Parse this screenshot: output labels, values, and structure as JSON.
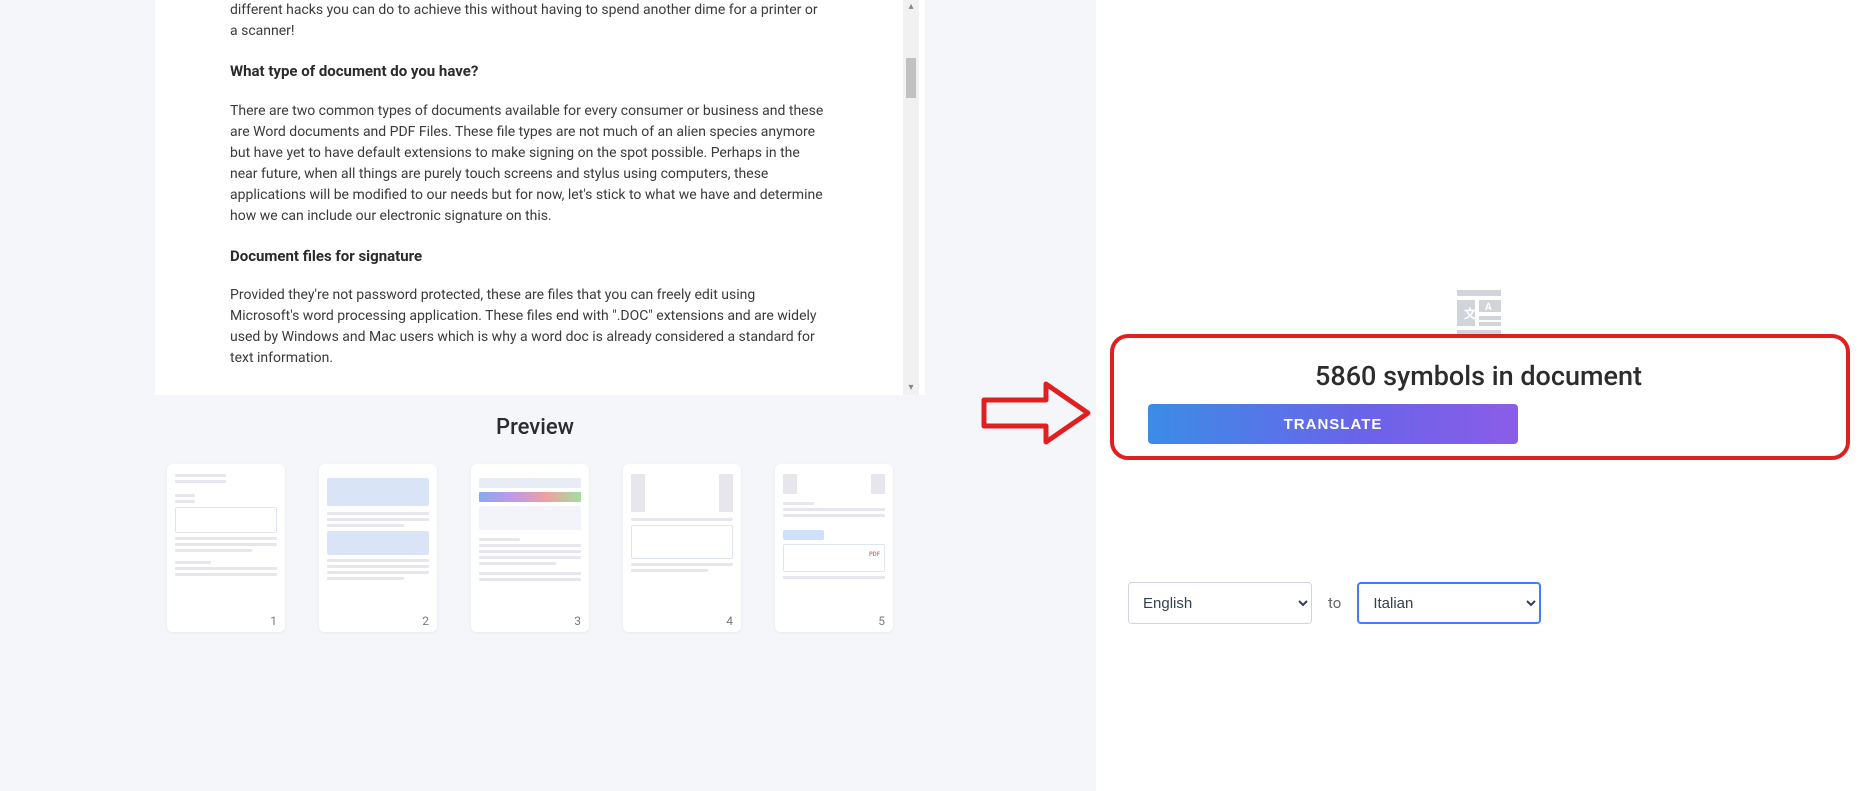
{
  "doc": {
    "p1": "different hacks you can do to achieve this without having to spend another dime for a printer or a scanner!",
    "h1": "What type of document do you have?",
    "p2": "There are two common types of documents available for every consumer or business and these are Word documents and PDF Files. These file types are not much of an alien species anymore but have yet to have default extensions to make signing on the spot possible. Perhaps in the near future, when all things are purely touch screens and stylus using computers, these applications will be modified to our needs but for now, let's stick to what we have and determine how we can include our electronic signature on this.",
    "h2": "Document files for signature",
    "p3": "Provided they're not password protected, these are files that you can freely edit using Microsoft's word processing application. These files end with \".DOC\" extensions and are widely used by Windows and Mac users which is why a word doc is already considered a standard for text information."
  },
  "preview": {
    "title": "Preview",
    "pages": [
      "1",
      "2",
      "3",
      "4",
      "5"
    ]
  },
  "translate": {
    "symbols_text": "5860 symbols in document",
    "button_label": "TRANSLATE",
    "source_lang": "English",
    "to_label": "to",
    "target_lang": "Italian",
    "lang_options_source": [
      "English"
    ],
    "lang_options_target": [
      "Italian"
    ]
  }
}
